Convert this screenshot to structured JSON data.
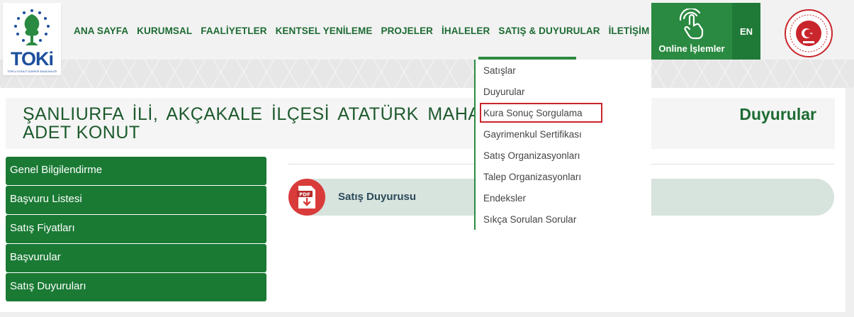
{
  "logo": {
    "text": "TOKi",
    "subtitle": "TOPLU KONUT İDARESİ BAŞKANLIĞI"
  },
  "nav": {
    "items": [
      "ANA SAYFA",
      "KURUMSAL",
      "FAALİYETLER",
      "KENTSEL YENİLEME",
      "PROJELER",
      "İHALELER",
      "SATIŞ & DUYURULAR",
      "İLETİŞİM"
    ]
  },
  "online": {
    "label": "Online İşlemler"
  },
  "lang": {
    "label": "EN"
  },
  "dropdown": {
    "items": [
      "Satışlar",
      "Duyurular",
      "Kura Sonuç Sorgulama",
      "Gayrimenkul Sertifikası",
      "Satış Organizasyonları",
      "Talep Organizasyonları",
      "Endeksler",
      "Sıkça Sorulan Sorular"
    ]
  },
  "page": {
    "title": "ŞANLIURFA İLİ, AKÇAKALE İLÇESİ ATATÜRK MAHAL ADET KONUT",
    "category": "Duyurular"
  },
  "sidebar": {
    "items": [
      "Genel Bilgilendirme",
      "Başvuru Listesi",
      "Satış Fiyatları",
      "Başvurular",
      "Satış Duyuruları"
    ]
  },
  "document": {
    "label": "Satış Duyurusu",
    "badge": "PDF"
  },
  "colors": {
    "brand_green": "#1a7a34",
    "highlight_red": "#c9252c",
    "pdf_red": "#d93b3b"
  }
}
